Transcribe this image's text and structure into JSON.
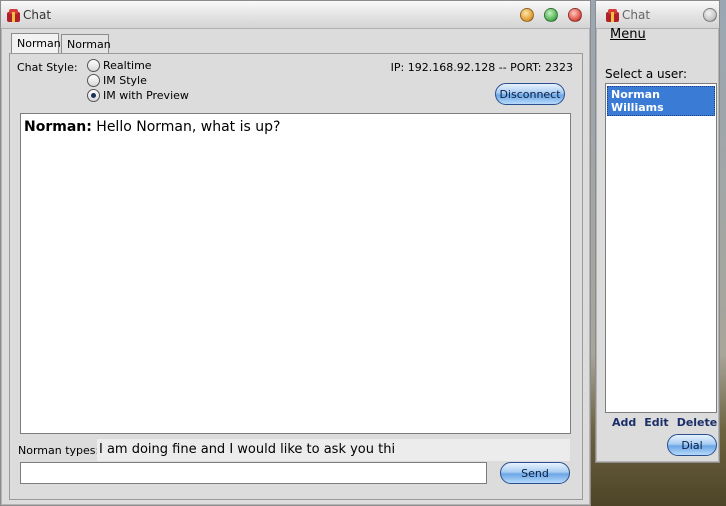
{
  "main_window": {
    "title": "Chat",
    "tabs": [
      {
        "label": "Norman",
        "active": true
      },
      {
        "label": "Norman",
        "active": false
      }
    ],
    "chat_style": {
      "label": "Chat Style:",
      "options": [
        "Realtime",
        "IM Style",
        "IM with Preview"
      ],
      "selected": "IM with Preview"
    },
    "connection_info": "IP: 192.168.92.128 -- PORT: 2323",
    "disconnect_label": "Disconnect",
    "transcript": [
      {
        "speaker": "Norman:",
        "text": " Hello Norman, what is up?"
      }
    ],
    "typing": {
      "label": "Norman types:",
      "preview": "I am doing fine and I would like to ask you thi"
    },
    "message_input": {
      "value": ""
    },
    "send_label": "Send"
  },
  "users_window": {
    "title": "Chat",
    "menu_label": "Menu",
    "select_user_label": "Select a user:",
    "users": [
      "Norman Williams"
    ],
    "selected_user": "Norman Williams",
    "actions": {
      "add": "Add",
      "edit": "Edit",
      "delete": "Delete"
    },
    "dial_label": "Dial"
  },
  "colors": {
    "close": "#e0584f",
    "minimize": "#e3a33a",
    "maximize": "#58b85a",
    "selection": "#3a7bd5"
  }
}
